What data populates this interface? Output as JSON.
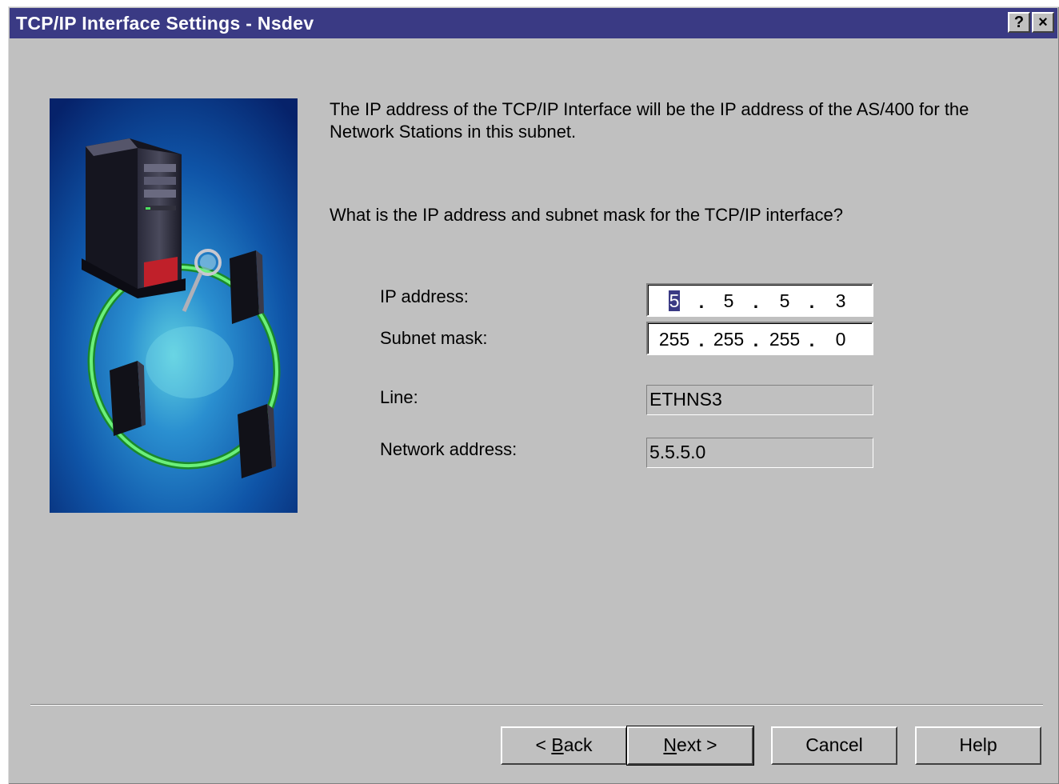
{
  "window": {
    "title": "TCP/IP Interface Settings - Nsdev",
    "help_glyph": "?",
    "close_glyph": "×"
  },
  "intro_text": "The IP address of the TCP/IP Interface will be the IP address of the AS/400 for the Network Stations in this subnet.",
  "question_text": "What is the IP address and subnet mask for the TCP/IP interface?",
  "fields": {
    "ip_address": {
      "label": "IP address:",
      "octets": [
        "5",
        "5",
        "5",
        "3"
      ],
      "selected_octet": 0
    },
    "subnet_mask": {
      "label": "Subnet mask:",
      "octets": [
        "255",
        "255",
        "255",
        "0"
      ]
    },
    "line": {
      "label": "Line:",
      "value": "ETHNS3"
    },
    "network_address": {
      "label": "Network address:",
      "value": "5.5.5.0"
    }
  },
  "buttons": {
    "back": {
      "prefix": "< ",
      "mnemonic": "B",
      "rest": "ack"
    },
    "next": {
      "mnemonic": "N",
      "rest": "ext >"
    },
    "cancel": "Cancel",
    "help": "Help"
  },
  "colors": {
    "titlebar": "#3a3a84",
    "dialog_bg": "#c0c0c0",
    "illustration_bg": "#0a3c8c",
    "ring": "#3bd24a"
  },
  "icons": {
    "illustration": "as400-server-network-illustration"
  }
}
